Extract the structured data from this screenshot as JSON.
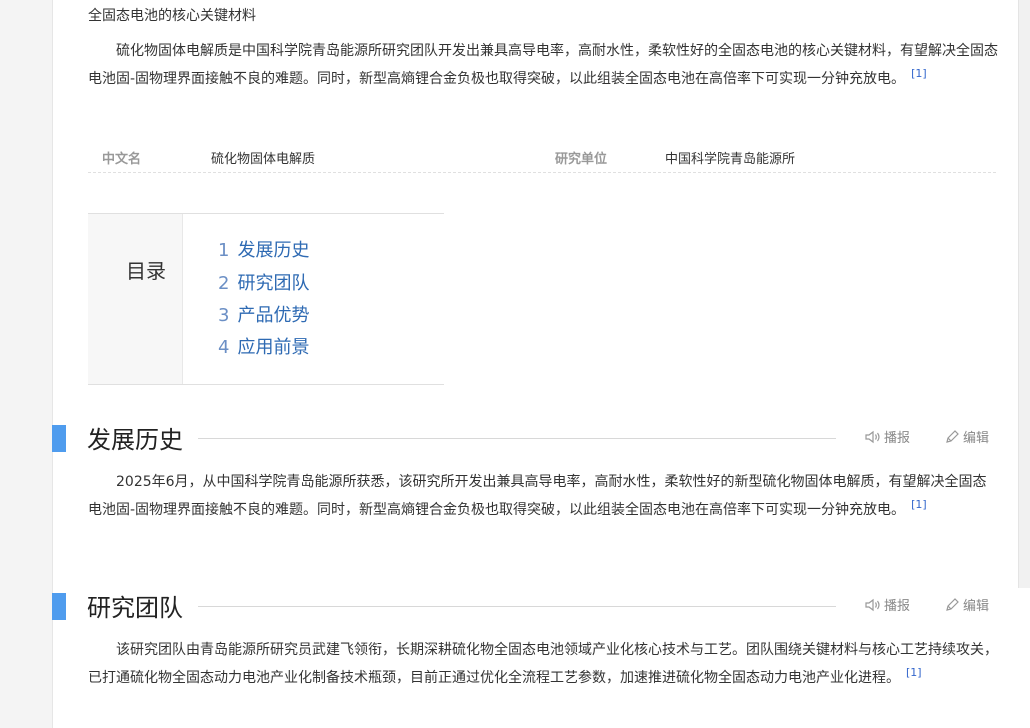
{
  "summary": {
    "subtitle": "全固态电池的核心关键材料",
    "paragraph": "硫化物固体电解质是中国科学院青岛能源所研究团队开发出兼具高导电率，高耐水性，柔软性好的全固态电池的核心关键材料，有望解决全固态电池固-固物理界面接触不良的难题。同时，新型高熵锂合金负极也取得突破，以此组装全固态电池在高倍率下可实现一分钟充放电。",
    "ref": "[1]"
  },
  "basic_info": [
    {
      "name": "中文名",
      "value": "硫化物固体电解质"
    },
    {
      "name": "研究单位",
      "value": "中国科学院青岛能源所"
    }
  ],
  "toc": {
    "title": "目录",
    "items": [
      {
        "num": "1",
        "label": "发展历史"
      },
      {
        "num": "2",
        "label": "研究团队"
      },
      {
        "num": "3",
        "label": "产品优势"
      },
      {
        "num": "4",
        "label": "应用前景"
      }
    ]
  },
  "sections": [
    {
      "title": "发展历史",
      "paragraph": "2025年6月，从中国科学院青岛能源所获悉，该研究所开发出兼具高导电率，高耐水性，柔软性好的新型硫化物固体电解质，有望解决全固态电池固-固物理界面接触不良的难题。同时，新型高熵锂合金负极也取得突破，以此组装全固态电池在高倍率下可实现一分钟充放电。",
      "ref": "[1]"
    },
    {
      "title": "研究团队",
      "paragraph": "该研究团队由青岛能源所研究员武建飞领衔，长期深耕硫化物全固态电池领域产业化核心技术与工艺。团队围绕关键材料与核心工艺持续攻关，已打通硫化物全固态动力电池产业化制备技术瓶颈，目前正通过优化全流程工艺参数，加速推进硫化物全固态动力电池产业化进程。",
      "ref": "[1]"
    }
  ],
  "tools": {
    "play": "播报",
    "edit": "编辑"
  },
  "icons": {
    "play": "speaker-icon",
    "edit": "pencil-icon"
  },
  "colors": {
    "link": "#2e6ab3",
    "section_bar": "#4f9cee",
    "ref": "#3366cc"
  }
}
